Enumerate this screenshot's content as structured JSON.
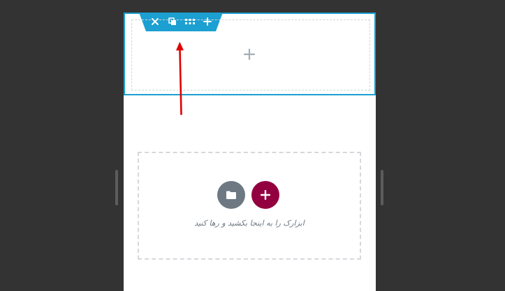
{
  "section_toolbar": {
    "accent": "#1c9fd1",
    "buttons": [
      {
        "icon": "close-icon"
      },
      {
        "icon": "duplicate-icon"
      },
      {
        "icon": "drag-handle-icon"
      },
      {
        "icon": "plus-icon"
      }
    ]
  },
  "column": {
    "add_icon": "plus-icon"
  },
  "dropzone": {
    "template_icon": "folder-icon",
    "add_icon": "plus-icon",
    "template_color": "#6d7882",
    "add_color": "#93003f",
    "text": "ابزارک را به اینجا بکشید و رها کنید"
  },
  "annotation": {
    "color": "#e10000"
  }
}
